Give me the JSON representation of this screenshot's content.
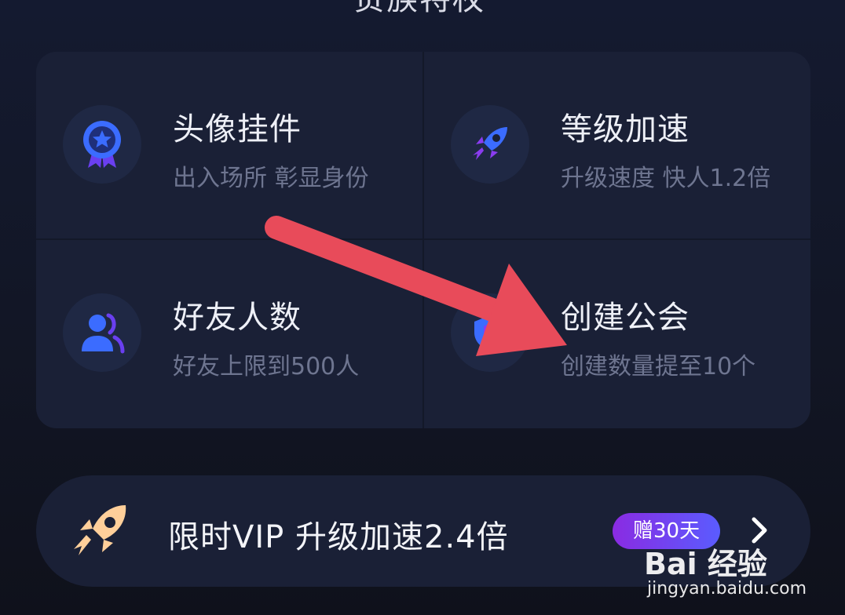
{
  "header": {
    "title": "贵族特权"
  },
  "benefits": [
    {
      "title": "头像挂件",
      "desc": "出入场所 彰显身份",
      "icon": "medal-icon"
    },
    {
      "title": "等级加速",
      "desc": "升级速度 快人1.2倍",
      "icon": "rocket-icon"
    },
    {
      "title": "好友人数",
      "desc": "好友上限到500人",
      "icon": "friends-icon"
    },
    {
      "title": "创建公会",
      "desc": "创建数量提至10个",
      "icon": "guild-icon"
    }
  ],
  "vip_banner": {
    "text": "限时VIP 升级加速2.4倍",
    "badge": "赠30天"
  },
  "watermark": {
    "brand": "Bai 经验",
    "url": "jingyan.baidu.com"
  },
  "colors": {
    "background": "#121625",
    "card": "#1a2036",
    "icon_blue": "#3b6cff",
    "icon_purple": "#8a3cf0",
    "arrow_red": "#e84b5a",
    "badge_gradient_start": "#8a2be2",
    "badge_gradient_end": "#5a5cff",
    "rocket_orange": "#ffcf9a"
  }
}
